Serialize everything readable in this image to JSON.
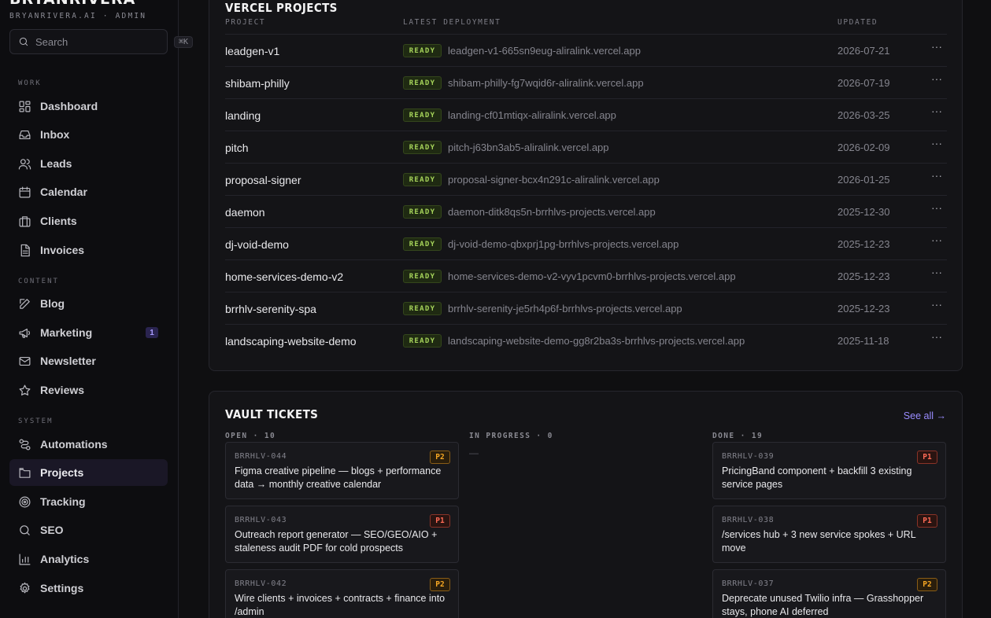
{
  "sidebar": {
    "brand": "BRYANRIVERA",
    "brand_sub": "BRYANRIVERA.AI · ADMIN",
    "search_placeholder": "Search",
    "search_shortcut": "⌘K",
    "sections": {
      "work": "WORK",
      "content": "CONTENT",
      "system": "SYSTEM"
    },
    "items": [
      {
        "label": "Dashboard",
        "icon": "dashboard-icon"
      },
      {
        "label": "Inbox",
        "icon": "inbox-icon"
      },
      {
        "label": "Leads",
        "icon": "users-icon"
      },
      {
        "label": "Calendar",
        "icon": "calendar-icon"
      },
      {
        "label": "Clients",
        "icon": "briefcase-icon"
      },
      {
        "label": "Invoices",
        "icon": "document-icon"
      },
      {
        "label": "Blog",
        "icon": "edit-icon"
      },
      {
        "label": "Marketing",
        "icon": "megaphone-icon",
        "badge": "1"
      },
      {
        "label": "Newsletter",
        "icon": "mail-icon"
      },
      {
        "label": "Reviews",
        "icon": "star-icon"
      },
      {
        "label": "Automations",
        "icon": "workflow-icon"
      },
      {
        "label": "Projects",
        "icon": "folder-icon",
        "active": true
      },
      {
        "label": "Tracking",
        "icon": "target-icon"
      },
      {
        "label": "SEO",
        "icon": "search-icon"
      },
      {
        "label": "Analytics",
        "icon": "bar-chart-icon"
      },
      {
        "label": "Settings",
        "icon": "gear-icon"
      }
    ]
  },
  "vercel": {
    "title": "VERCEL PROJECTS",
    "columns": {
      "project": "PROJECT",
      "deployment": "LATEST DEPLOYMENT",
      "updated": "UPDATED"
    },
    "status_label": "READY",
    "rows": [
      {
        "name": "leadgen-v1",
        "url": "leadgen-v1-665sn9eug-aliralink.vercel.app",
        "updated": "2026-07-21"
      },
      {
        "name": "shibam-philly",
        "url": "shibam-philly-fg7wqid6r-aliralink.vercel.app",
        "updated": "2026-07-19"
      },
      {
        "name": "landing",
        "url": "landing-cf01mtiqx-aliralink.vercel.app",
        "updated": "2026-03-25"
      },
      {
        "name": "pitch",
        "url": "pitch-j63bn3ab5-aliralink.vercel.app",
        "updated": "2026-02-09"
      },
      {
        "name": "proposal-signer",
        "url": "proposal-signer-bcx4n291c-aliralink.vercel.app",
        "updated": "2026-01-25"
      },
      {
        "name": "daemon",
        "url": "daemon-ditk8qs5n-brrhlvs-projects.vercel.app",
        "updated": "2025-12-30"
      },
      {
        "name": "dj-void-demo",
        "url": "dj-void-demo-qbxprj1pg-brrhlvs-projects.vercel.app",
        "updated": "2025-12-23"
      },
      {
        "name": "home-services-demo-v2",
        "url": "home-services-demo-v2-vyv1pcvm0-brrhlvs-projects.vercel.app",
        "updated": "2025-12-23"
      },
      {
        "name": "brrhlv-serenity-spa",
        "url": "brrhlv-serenity-je5rh4p6f-brrhlvs-projects.vercel.app",
        "updated": "2025-12-23"
      },
      {
        "name": "landscaping-website-demo",
        "url": "landscaping-website-demo-gg8r2ba3s-brrhlvs-projects.vercel.app",
        "updated": "2025-11-18"
      }
    ]
  },
  "vault": {
    "title": "VAULT TICKETS",
    "see_all": "See all →",
    "columns": {
      "open": "OPEN · 10",
      "in_progress": "IN PROGRESS · 0",
      "done": "DONE · 19"
    },
    "empty_marker": "—",
    "open_tickets": [
      {
        "id": "BRRHLV-044",
        "priority": "P2",
        "title": "Figma creative pipeline — blogs + performance data → monthly creative calendar"
      },
      {
        "id": "BRRHLV-043",
        "priority": "P1",
        "title": "Outreach report generator — SEO/GEO/AIO + staleness audit PDF for cold prospects"
      },
      {
        "id": "BRRHLV-042",
        "priority": "P2",
        "title": "Wire clients + invoices + contracts + finance into /admin"
      }
    ],
    "done_tickets": [
      {
        "id": "BRRHLV-039",
        "priority": "P1",
        "title": "PricingBand component + backfill 3 existing service pages"
      },
      {
        "id": "BRRHLV-038",
        "priority": "P1",
        "title": "/services hub + 3 new service spokes + URL move"
      },
      {
        "id": "BRRHLV-037",
        "priority": "P2",
        "title": "Deprecate unused Twilio infra — Grasshopper stays, phone AI deferred"
      }
    ]
  },
  "colors": {
    "accent": "#9a8cff",
    "ready": "#a6d45a",
    "p1": "#ff6a55",
    "p2": "#f5a623"
  }
}
